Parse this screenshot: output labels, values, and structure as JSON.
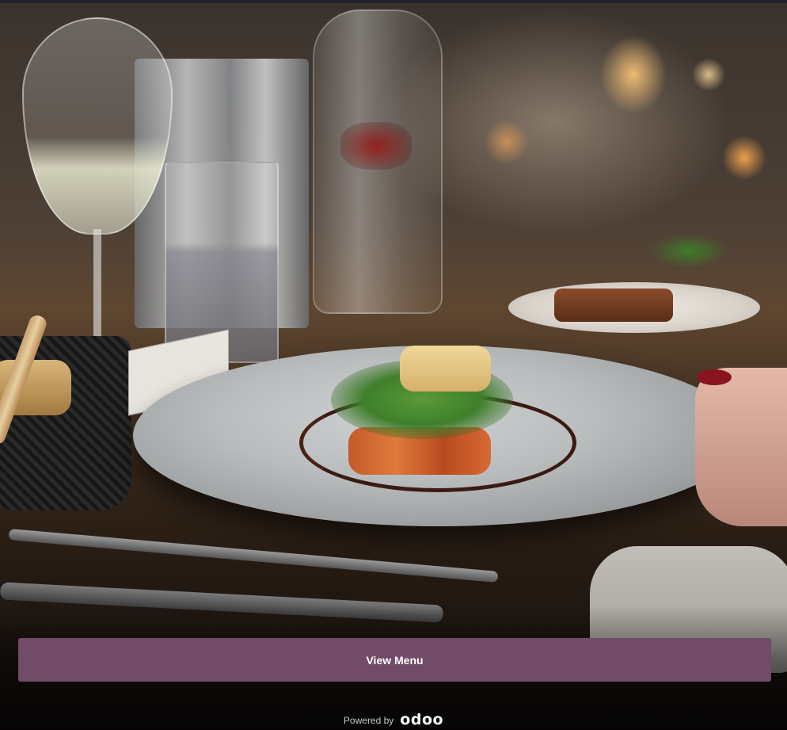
{
  "hero": {
    "image_description_icon": "restaurant-dish-photo"
  },
  "cta": {
    "view_menu_label": "View Menu",
    "button_color": "#714b67",
    "text_color": "#ffffff"
  },
  "footer": {
    "powered_by_label": "Powered by",
    "brand_logo_text": "odoo"
  }
}
